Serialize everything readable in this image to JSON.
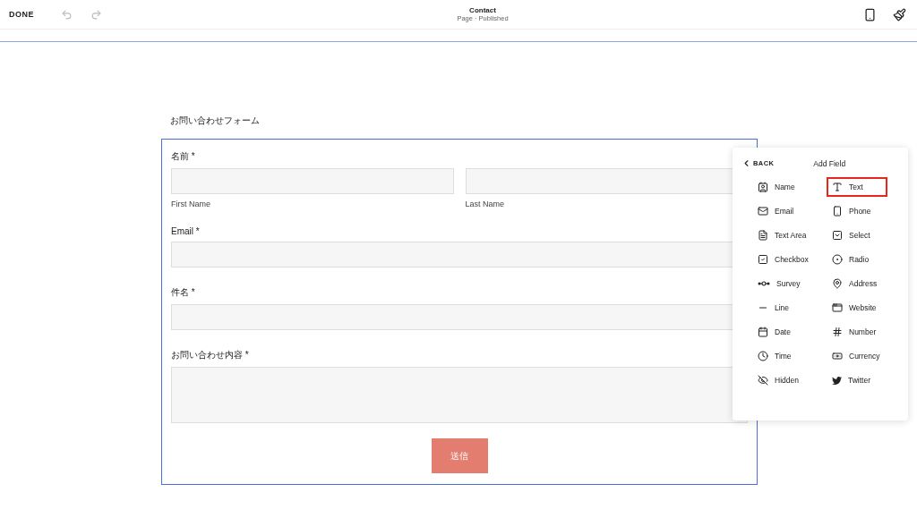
{
  "toolbar": {
    "done": "DONE",
    "title": "Contact",
    "subtitle": "Page · Published"
  },
  "form": {
    "title": "お問い合わせフォーム",
    "fields": [
      {
        "kind": "name",
        "label": "名前 *",
        "sublabels": [
          "First Name",
          "Last Name"
        ]
      },
      {
        "kind": "text",
        "label": "Email *"
      },
      {
        "kind": "text",
        "label": "件名 *"
      },
      {
        "kind": "textarea",
        "label": "お問い合わせ内容 *"
      }
    ],
    "submit": "送信"
  },
  "panel": {
    "back": "BACK",
    "title": "Add Field",
    "items": [
      {
        "kind": "name",
        "label": "Name",
        "highlighted": false
      },
      {
        "kind": "text",
        "label": "Text",
        "highlighted": true
      },
      {
        "kind": "email",
        "label": "Email",
        "highlighted": false
      },
      {
        "kind": "phone",
        "label": "Phone",
        "highlighted": false
      },
      {
        "kind": "textarea",
        "label": "Text Area",
        "highlighted": false
      },
      {
        "kind": "select",
        "label": "Select",
        "highlighted": false
      },
      {
        "kind": "checkbox",
        "label": "Checkbox",
        "highlighted": false
      },
      {
        "kind": "radio",
        "label": "Radio",
        "highlighted": false
      },
      {
        "kind": "survey",
        "label": "Survey",
        "highlighted": false
      },
      {
        "kind": "address",
        "label": "Address",
        "highlighted": false
      },
      {
        "kind": "line",
        "label": "Line",
        "highlighted": false
      },
      {
        "kind": "website",
        "label": "Website",
        "highlighted": false
      },
      {
        "kind": "date",
        "label": "Date",
        "highlighted": false
      },
      {
        "kind": "number",
        "label": "Number",
        "highlighted": false
      },
      {
        "kind": "time",
        "label": "Time",
        "highlighted": false
      },
      {
        "kind": "currency",
        "label": "Currency",
        "highlighted": false
      },
      {
        "kind": "hidden",
        "label": "Hidden",
        "highlighted": false
      },
      {
        "kind": "twitter",
        "label": "Twitter",
        "highlighted": false
      }
    ]
  }
}
